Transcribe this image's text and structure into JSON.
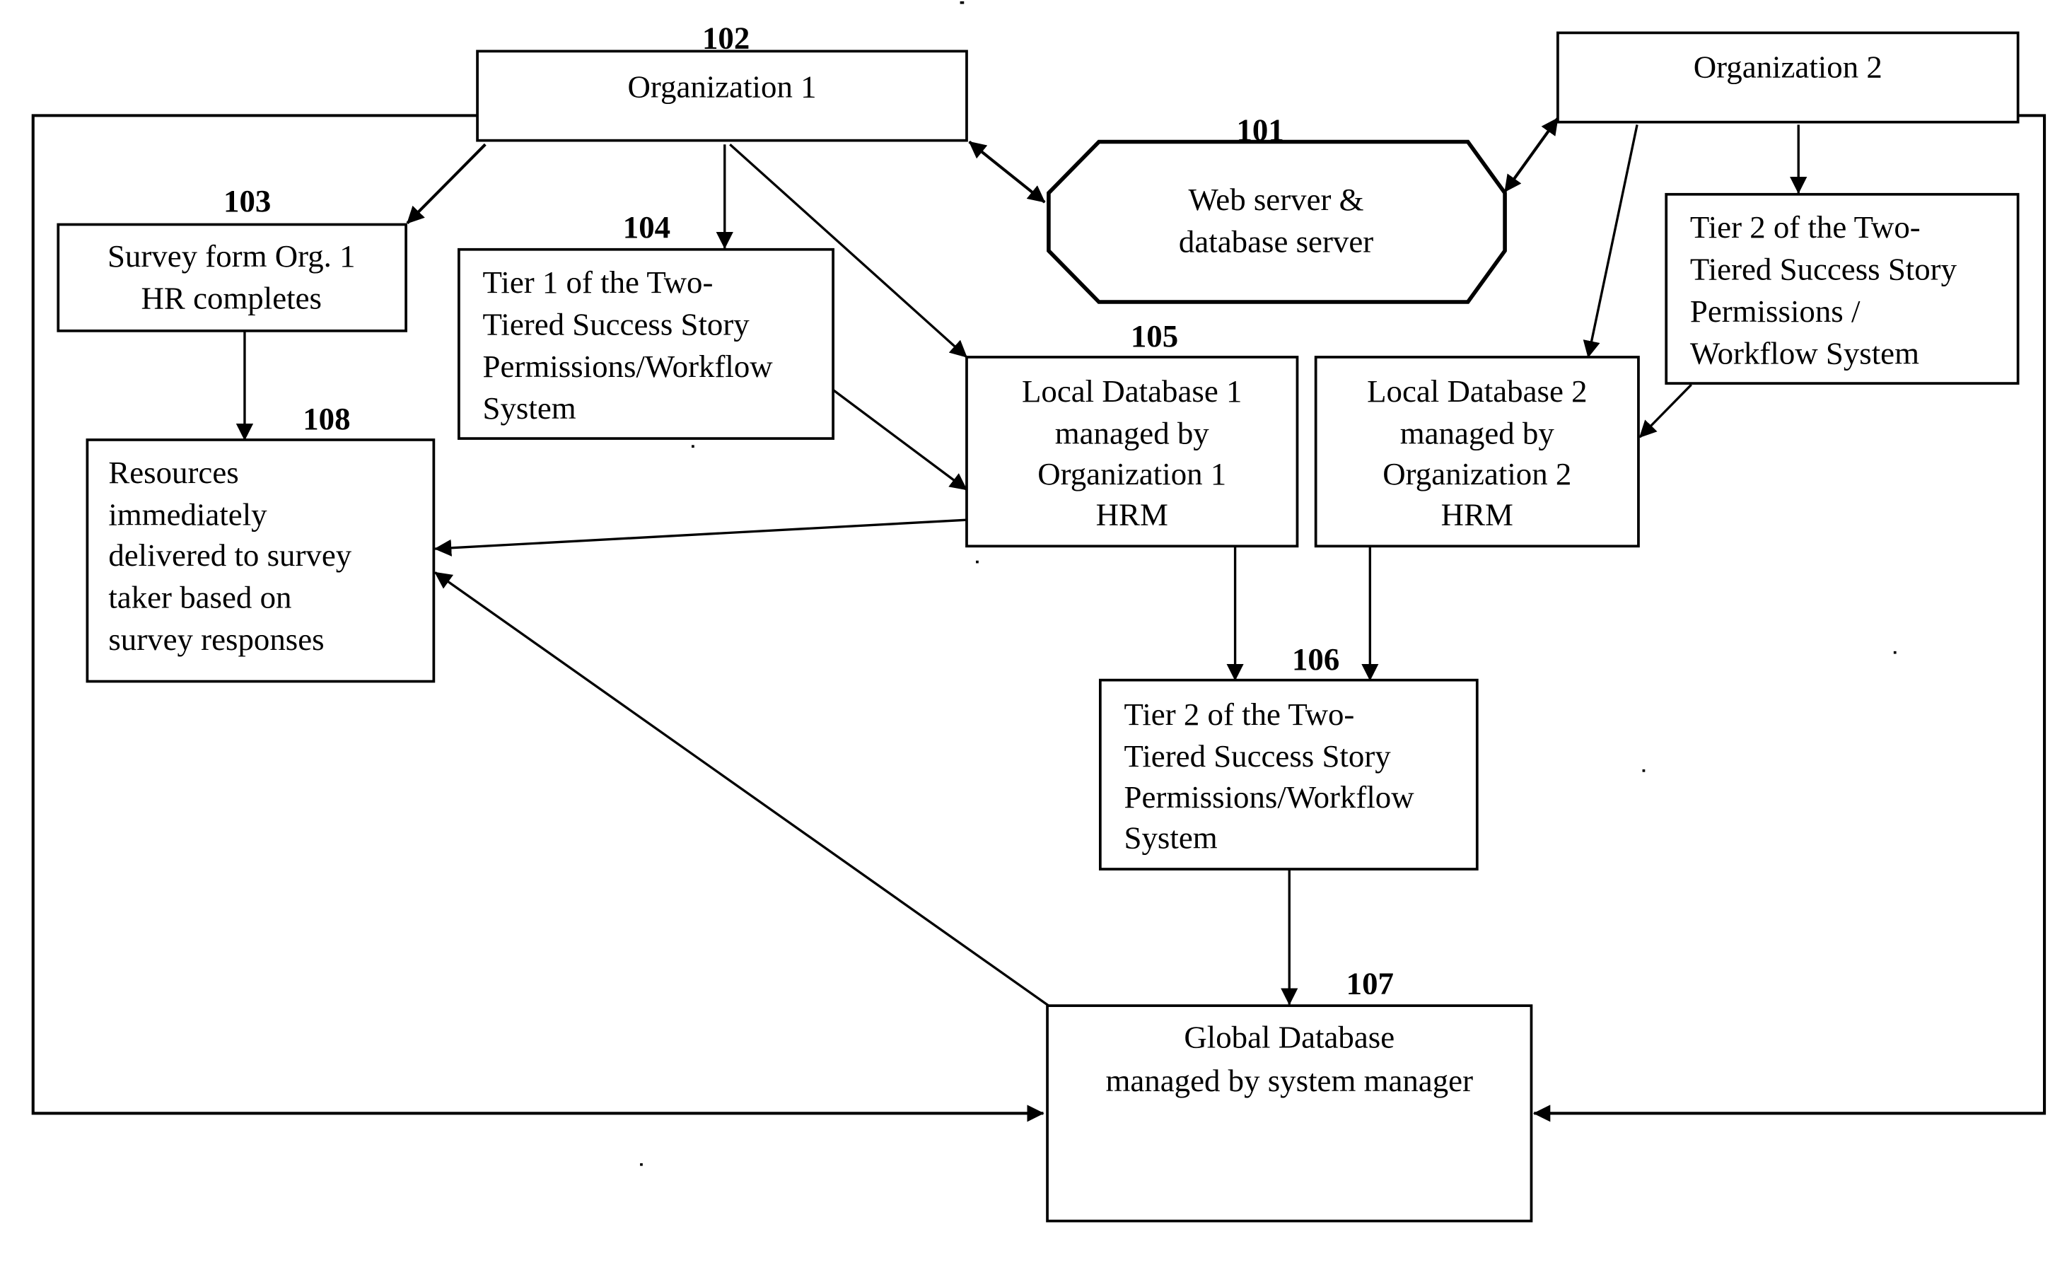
{
  "diagram": {
    "nodes": {
      "web_server": {
        "ref": "101",
        "lines": [
          "Web server &",
          "database server"
        ]
      },
      "org1": {
        "ref": "102",
        "lines": [
          "Organization 1"
        ]
      },
      "org2": {
        "ref": "",
        "lines": [
          "Organization 2"
        ]
      },
      "survey_form": {
        "ref": "103",
        "lines": [
          "Survey form Org. 1",
          "HR completes"
        ]
      },
      "tier1": {
        "ref": "104",
        "lines": [
          "Tier 1 of the Two-",
          "Tiered Success Story",
          "Permissions/Workflow",
          "System"
        ]
      },
      "local_db1": {
        "ref": "105",
        "lines": [
          "Local Database 1",
          "managed by",
          "Organization 1",
          "HRM"
        ]
      },
      "local_db2": {
        "ref": "",
        "lines": [
          "Local Database 2",
          "managed by",
          "Organization 2",
          "HRM"
        ]
      },
      "tier2_org2": {
        "ref": "",
        "lines": [
          "Tier 2 of the Two-",
          "Tiered Success Story",
          "Permissions /",
          "Workflow System"
        ]
      },
      "tier2": {
        "ref": "106",
        "lines": [
          "Tier 2 of the Two-",
          "Tiered Success Story",
          "Permissions/Workflow",
          "System"
        ]
      },
      "global_db": {
        "ref": "107",
        "lines": [
          "Global Database",
          "managed by system manager"
        ]
      },
      "resources": {
        "ref": "108",
        "lines": [
          "Resources",
          "immediately",
          "delivered to survey",
          "taker based on",
          "survey responses"
        ]
      }
    },
    "edges": [
      {
        "from": "org1",
        "to": "web_server",
        "bidirectional": true
      },
      {
        "from": "org2",
        "to": "web_server",
        "bidirectional": true
      },
      {
        "from": "org1",
        "to": "survey_form"
      },
      {
        "from": "org1",
        "to": "tier1"
      },
      {
        "from": "org1",
        "to": "local_db1"
      },
      {
        "from": "org1",
        "to": "global_db"
      },
      {
        "from": "org2",
        "to": "local_db2"
      },
      {
        "from": "org2",
        "to": "tier2_org2"
      },
      {
        "from": "org2",
        "to": "global_db"
      },
      {
        "from": "survey_form",
        "to": "resources"
      },
      {
        "from": "tier1",
        "to": "local_db1"
      },
      {
        "from": "tier2_org2",
        "to": "local_db2"
      },
      {
        "from": "local_db1",
        "to": "resources"
      },
      {
        "from": "local_db1",
        "to": "tier2"
      },
      {
        "from": "local_db2",
        "to": "tier2"
      },
      {
        "from": "tier2",
        "to": "global_db"
      },
      {
        "from": "global_db",
        "to": "resources"
      }
    ]
  }
}
